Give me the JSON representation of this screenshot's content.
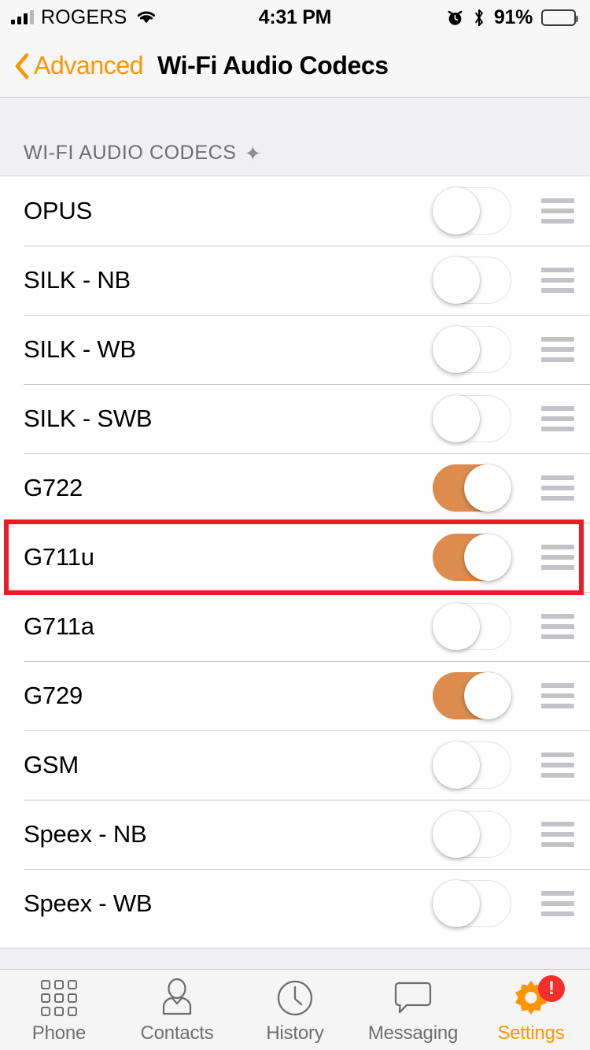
{
  "status_bar": {
    "carrier": "ROGERS",
    "signal_bars_filled": 3,
    "signal_bars_total": 4,
    "wifi_icon": "wifi-icon",
    "time": "4:31 PM",
    "alarm_icon": "alarm-clock-icon",
    "bluetooth_icon": "bluetooth-icon",
    "battery_percent": "91%",
    "battery_level": 91
  },
  "nav_bar": {
    "back_icon": "chevron-left-icon",
    "back_label": "Advanced",
    "title": "Wi-Fi Audio Codecs",
    "accent_color": "#ff9500"
  },
  "section": {
    "header": "WI-FI AUDIO CODECS",
    "header_icon": "sparkle-icon",
    "header_icon_glyph": "✦"
  },
  "codecs": [
    {
      "label": "OPUS",
      "enabled": false,
      "drag_handle": "reorder-handle-icon"
    },
    {
      "label": "SILK - NB",
      "enabled": false,
      "drag_handle": "reorder-handle-icon"
    },
    {
      "label": "SILK - WB",
      "enabled": false,
      "drag_handle": "reorder-handle-icon"
    },
    {
      "label": "SILK - SWB",
      "enabled": false,
      "drag_handle": "reorder-handle-icon"
    },
    {
      "label": "G722",
      "enabled": true,
      "drag_handle": "reorder-handle-icon"
    },
    {
      "label": "G711u",
      "enabled": true,
      "drag_handle": "reorder-handle-icon"
    },
    {
      "label": "G711a",
      "enabled": false,
      "drag_handle": "reorder-handle-icon"
    },
    {
      "label": "G729",
      "enabled": true,
      "drag_handle": "reorder-handle-icon"
    },
    {
      "label": "GSM",
      "enabled": false,
      "drag_handle": "reorder-handle-icon"
    },
    {
      "label": "Speex - NB",
      "enabled": false,
      "drag_handle": "reorder-handle-icon"
    },
    {
      "label": "Speex - WB",
      "enabled": false,
      "drag_handle": "reorder-handle-icon"
    }
  ],
  "highlight": {
    "target_row_label": "G711u",
    "color": "#ed1c24"
  },
  "toggle_colors": {
    "on": "#dd8c4e",
    "off_track": "#ffffff",
    "knob": "#ffffff"
  },
  "tab_bar": {
    "items": [
      {
        "label": "Phone",
        "icon": "keypad-icon",
        "active": false
      },
      {
        "label": "Contacts",
        "icon": "person-icon",
        "active": false
      },
      {
        "label": "History",
        "icon": "clock-icon",
        "active": false
      },
      {
        "label": "Messaging",
        "icon": "speech-bubble-icon",
        "active": false
      },
      {
        "label": "Settings",
        "icon": "gear-icon",
        "active": true,
        "badge": "!"
      }
    ]
  }
}
